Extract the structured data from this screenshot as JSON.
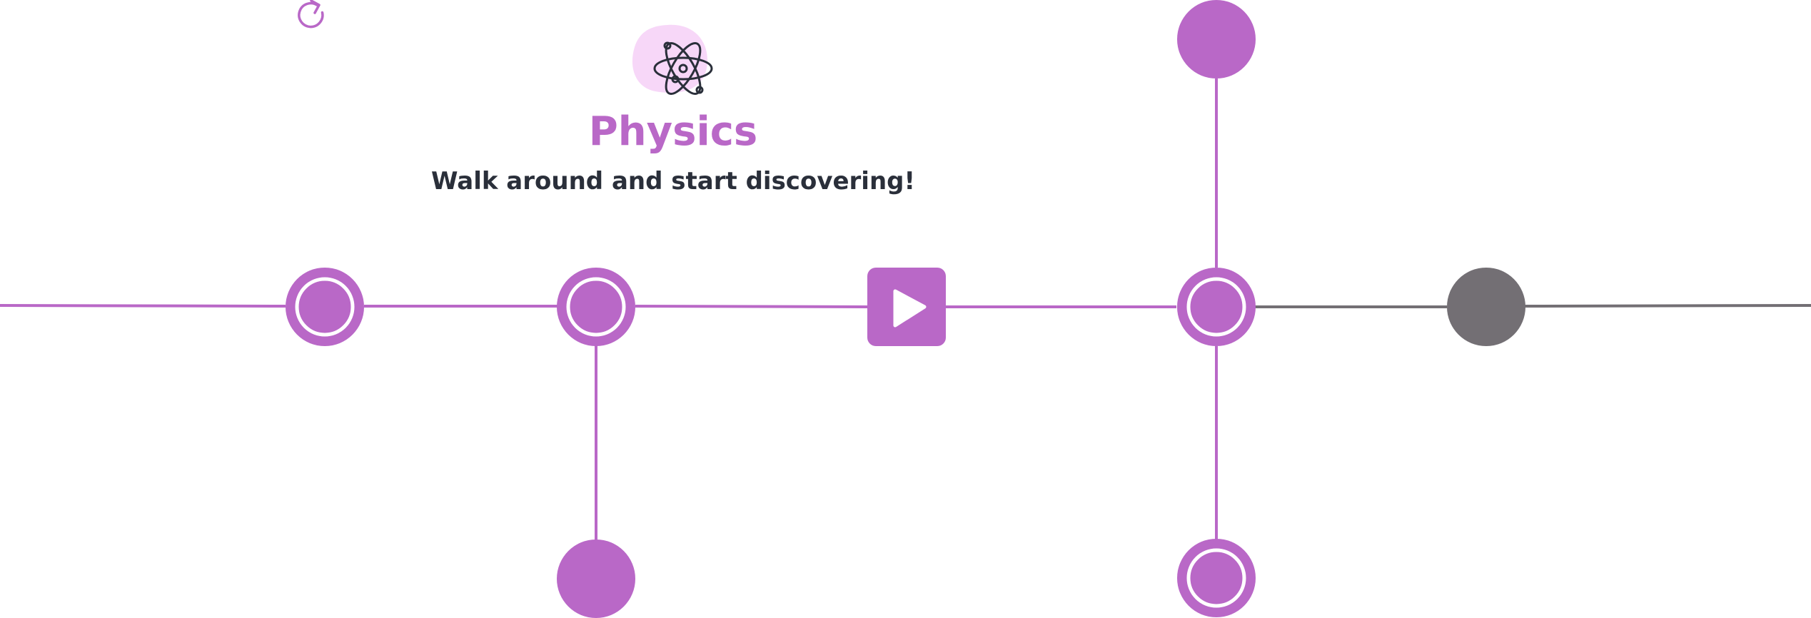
{
  "subject": {
    "title": "Physics",
    "tagline": "Walk around and start discovering!",
    "icon": "atom-icon"
  },
  "controls": {
    "restart_icon": "restart-icon"
  },
  "path_map": {
    "node_types": [
      "lesson-completed",
      "lesson-available",
      "start-current",
      "locked"
    ],
    "nodes": [
      {
        "id": "lesson-1",
        "type": "lesson-completed"
      },
      {
        "id": "lesson-2",
        "type": "lesson-completed"
      },
      {
        "id": "lesson-2-branch",
        "type": "lesson-available"
      },
      {
        "id": "current-lesson",
        "type": "start-current"
      },
      {
        "id": "junction",
        "type": "lesson-completed"
      },
      {
        "id": "junction-top",
        "type": "lesson-available"
      },
      {
        "id": "junction-bottom",
        "type": "lesson-completed"
      },
      {
        "id": "locked-lesson",
        "type": "locked"
      }
    ]
  },
  "colors": {
    "accent": "#b968c7",
    "accent_light": "#f7d7f8",
    "locked": "#736f74",
    "text_dark": "#2a2f3a",
    "background": "#ffffff"
  }
}
